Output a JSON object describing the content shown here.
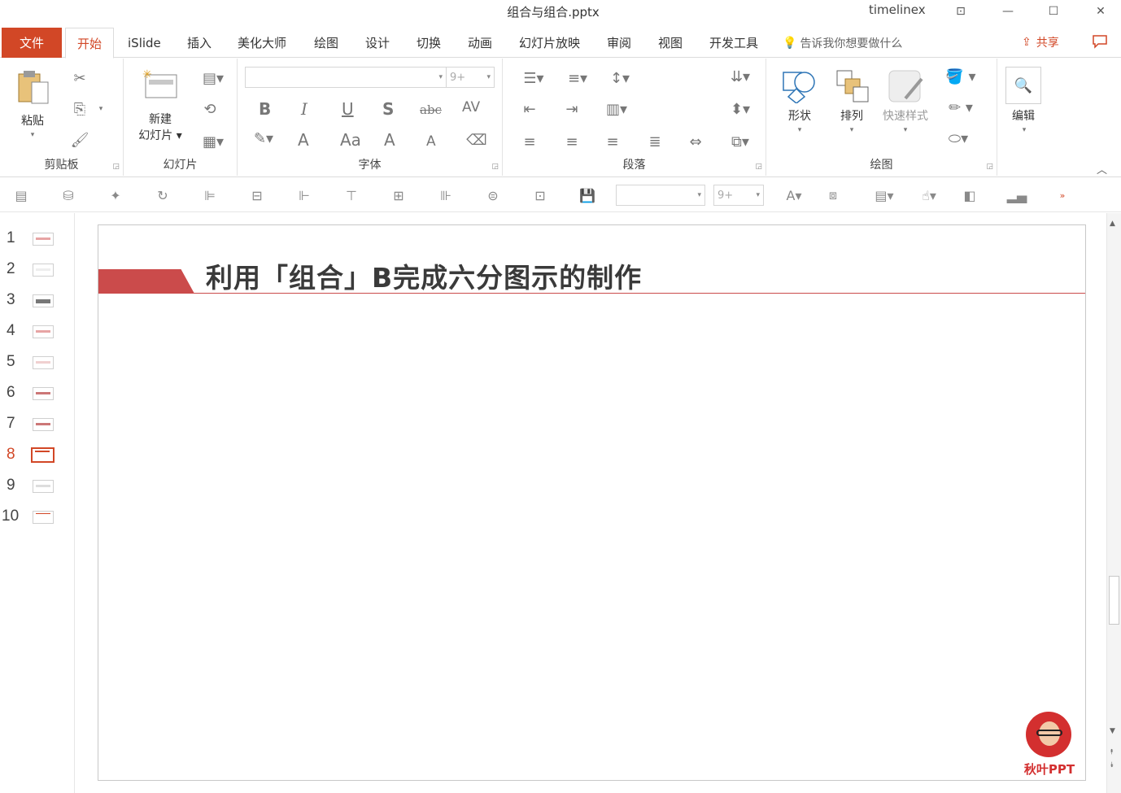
{
  "window": {
    "title": "组合与组合.pptx",
    "user": "timelinex",
    "buttons": {
      "ribbon_display": "⊡",
      "minimize": "—",
      "maximize": "☐",
      "close": "✕"
    }
  },
  "tabs": {
    "file": "文件",
    "items": [
      "开始",
      "iSlide",
      "插入",
      "美化大师",
      "绘图",
      "设计",
      "切换",
      "动画",
      "幻灯片放映",
      "审阅",
      "视图",
      "开发工具"
    ],
    "active": "开始",
    "tell_me": "告诉我你想要做什么",
    "share": "共享"
  },
  "ribbon": {
    "clipboard": {
      "label": "剪贴板",
      "paste": "粘贴"
    },
    "slides": {
      "label": "幻灯片",
      "new_slide_1": "新建",
      "new_slide_2": "幻灯片"
    },
    "font": {
      "label": "字体",
      "font_name": "",
      "font_size": "9+",
      "bold": "B",
      "italic": "I",
      "underline": "U",
      "shadow": "S",
      "strike": "abc",
      "spacing": "AV",
      "color_a": "A",
      "case": "Aa",
      "grow": "A",
      "shrink": "A"
    },
    "paragraph": {
      "label": "段落"
    },
    "drawing": {
      "label": "绘图",
      "shapes": "形状",
      "arrange": "排列",
      "quick_styles": "快速样式"
    },
    "editing": {
      "label": "编辑"
    }
  },
  "toolbar2": {
    "font_size": "9+",
    "font_name": ""
  },
  "slides_panel": {
    "numbers": [
      "1",
      "2",
      "3",
      "4",
      "5",
      "6",
      "7",
      "8",
      "9",
      "10"
    ],
    "active": "8"
  },
  "slide": {
    "title": "利用「组合」B完成六分图示的制作",
    "logo_text": "秋叶PPT",
    "accent_color": "#cb4b4b"
  },
  "colors": {
    "accent": "#d24726"
  }
}
